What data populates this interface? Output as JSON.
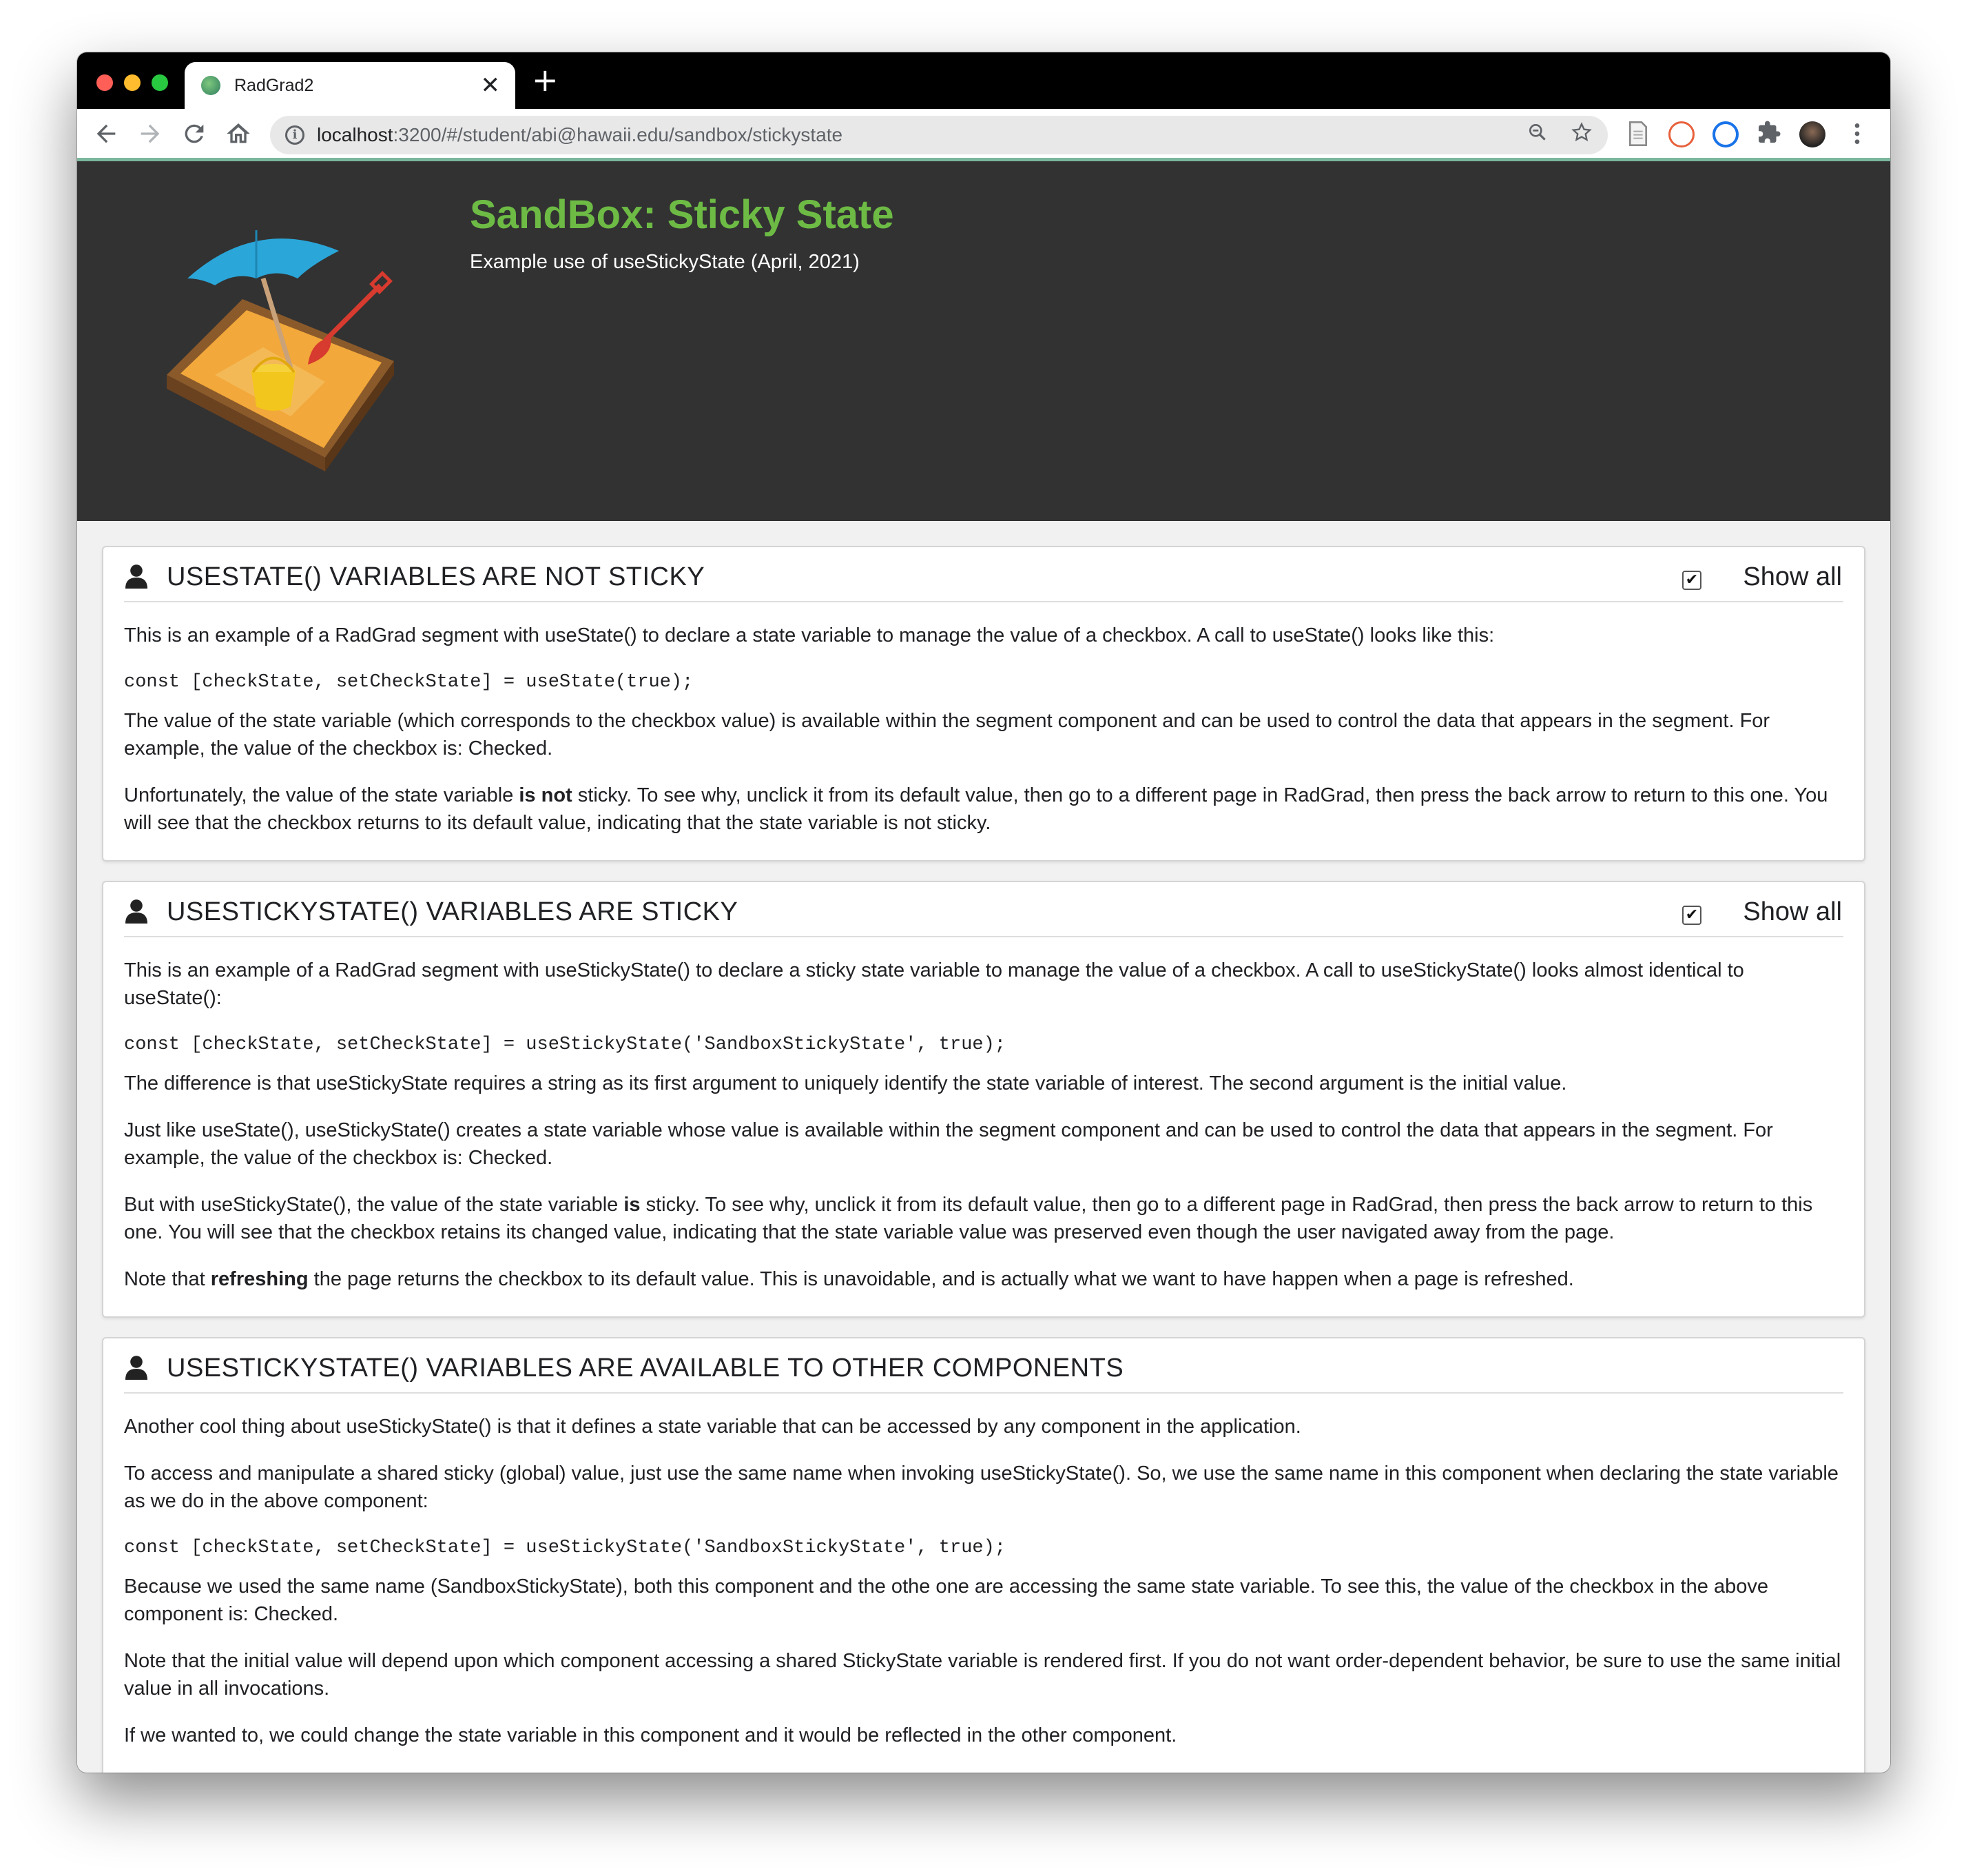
{
  "browser": {
    "tab_title": "RadGrad2",
    "tab_close": "✕",
    "new_tab": "+",
    "url_host": "localhost",
    "url_rest": ":3200/#/student/abi@hawaii.edu/sandbox/stickystate"
  },
  "hero": {
    "title": "SandBox: Sticky State",
    "subtitle": "Example use of useStickyState (April, 2021)"
  },
  "segments": [
    {
      "title": "USESTATE() VARIABLES ARE NOT STICKY",
      "show_all_label": "Show all",
      "checked": true,
      "p1": "This is an example of a RadGrad segment with useState() to declare a state variable to manage the value of a checkbox. A call to useState() looks like this:",
      "code": "const [checkState, setCheckState] = useState(true);",
      "p2": "The value of the state variable (which corresponds to the checkbox value) is available within the segment component and can be used to control the data that appears in the segment. For example, the value of the checkbox is: Checked.",
      "p3_pre": "Unfortunately, the value of the state variable ",
      "p3_bold": "is not",
      "p3_post": " sticky. To see why, unclick it from its default value, then go to a different page in RadGrad, then press the back arrow to return to this one. You will see that the checkbox returns to its default value, indicating that the state variable is not sticky."
    },
    {
      "title": "USESTICKYSTATE() VARIABLES ARE STICKY",
      "show_all_label": "Show all",
      "checked": true,
      "p1": "This is an example of a RadGrad segment with useStickyState() to declare a sticky state variable to manage the value of a checkbox. A call to useStickyState() looks almost identical to useState():",
      "code": "const [checkState, setCheckState] = useStickyState('SandboxStickyState', true);",
      "p2": "The difference is that useStickyState requires a string as its first argument to uniquely identify the state variable of interest. The second argument is the initial value.",
      "p3": "Just like useState(), useStickyState() creates a state variable whose value is available within the segment component and can be used to control the data that appears in the segment. For example, the value of the checkbox is: Checked.",
      "p4_pre": "But with useStickyState(), the value of the state variable ",
      "p4_bold": "is",
      "p4_post": " sticky. To see why, unclick it from its default value, then go to a different page in RadGrad, then press the back arrow to return to this one. You will see that the checkbox retains its changed value, indicating that the state variable value was preserved even though the user navigated away from the page.",
      "p5_pre": "Note that ",
      "p5_bold": "refreshing",
      "p5_post": " the page returns the checkbox to its default value. This is unavoidable, and is actually what we want to have happen when a page is refreshed."
    },
    {
      "title": "USESTICKYSTATE() VARIABLES ARE AVAILABLE TO OTHER COMPONENTS",
      "p1": "Another cool thing about useStickyState() is that it defines a state variable that can be accessed by any component in the application.",
      "p2": "To access and manipulate a shared sticky (global) value, just use the same name when invoking useStickyState(). So, we use the same name in this component when declaring the state variable as we do in the above component:",
      "code": "const [checkState, setCheckState] = useStickyState('SandboxStickyState', true);",
      "p3": "Because we used the same name (SandboxStickyState), both this component and the othe one are accessing the same state variable. To see this, the value of the checkbox in the above component is: Checked.",
      "p4": "Note that the initial value will depend upon which component accessing a shared StickyState variable is rendered first. If you do not want order-dependent behavior, be sure to use the same initial value in all invocations.",
      "p5": "If we wanted to, we could change the state variable in this component and it would be reflected in the other component."
    }
  ],
  "colors": {
    "hero_bg": "#323232",
    "title_green": "#6dbb45",
    "accent_line": "#7bb79d"
  },
  "icons": [
    "back-arrow-icon",
    "forward-arrow-icon",
    "reload-icon",
    "home-icon",
    "info-icon",
    "zoom-icon",
    "star-icon",
    "reader-icon",
    "extension-icon",
    "user-icon",
    "kebab-menu-icon"
  ]
}
